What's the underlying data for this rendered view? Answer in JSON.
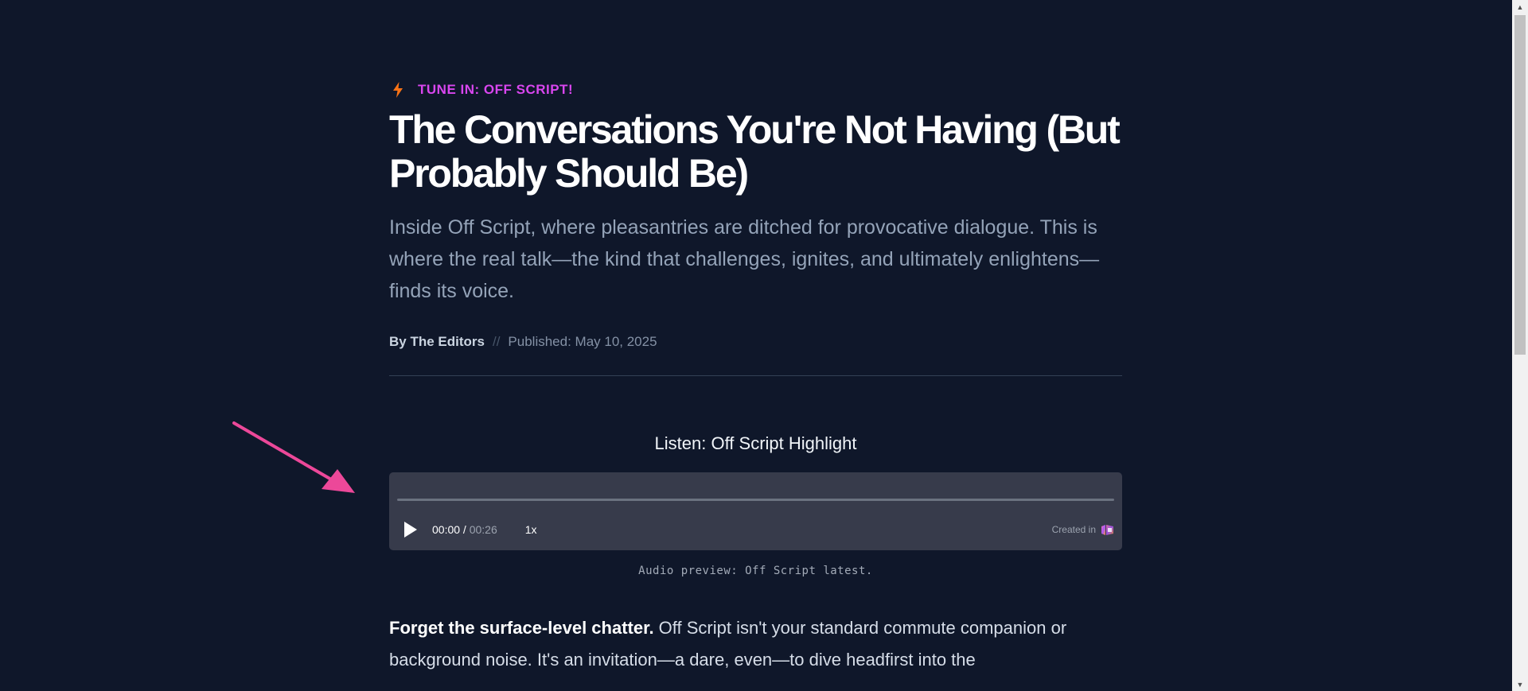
{
  "article": {
    "kicker_icon": "lightning-bolt-icon",
    "kicker": "TUNE IN: OFF SCRIPT!",
    "title": "The Conversations You're Not Having (But Probably Should Be)",
    "subtitle": "Inside Off Script, where pleasantries are ditched for provocative dialogue. This is where the real talk—the kind that challenges, ignites, and ultimately enlightens—finds its voice.",
    "byline": {
      "author": "By The Editors",
      "separator": "//",
      "published": "Published: May 10, 2025"
    },
    "listen_heading": "Listen: Off Script Highlight",
    "player": {
      "current_time": "00:00",
      "time_separator": " / ",
      "duration": "00:26",
      "speed": "1x",
      "created_in": "Created in",
      "progress": 0
    },
    "caption": "Audio preview: Off Script latest.",
    "body": {
      "lead": "Forget the surface-level chatter.",
      "text": " Off Script isn't your standard commute companion or background noise. It's an invitation—a dare, even—to dive headfirst into the"
    }
  },
  "colors": {
    "background": "#0f172a",
    "kicker": "#d946ef",
    "bolt": "#f97316",
    "arrow": "#ec4899",
    "player_bg": "#373b4b"
  }
}
